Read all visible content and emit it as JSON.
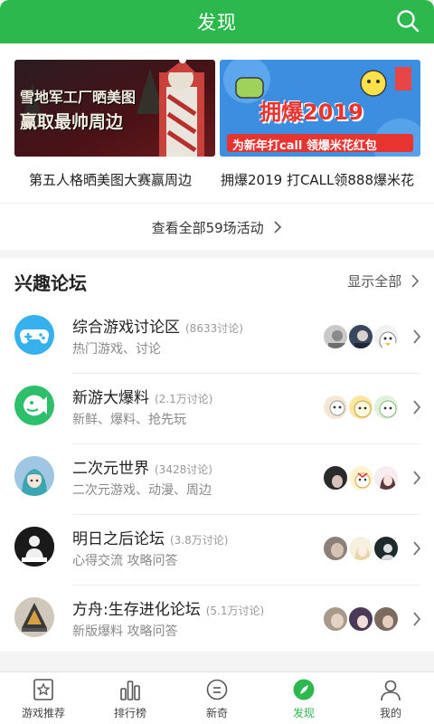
{
  "header": {
    "title": "发现"
  },
  "banners": [
    {
      "image_text_line1": "雪地军工厂晒美图",
      "image_text_line2": "赢取最帅周边",
      "caption": "第五人格晒美图大赛赢周边"
    },
    {
      "image_text_line1": "拥爆2019",
      "image_text_line2": "为新年打call 领爆米花红包",
      "caption": "拥爆2019 打CALL领888爆米花"
    }
  ],
  "all_events": {
    "label": "查看全部59场活动"
  },
  "forum": {
    "title": "兴趣论坛",
    "show_all": "显示全部",
    "items": [
      {
        "name": "综合游戏讨论区",
        "count": "(8633讨论)",
        "sub": "热门游戏、讨论",
        "icon": "gamepad-icon"
      },
      {
        "name": "新游大爆料",
        "count": "(2.1万讨论)",
        "sub": "新鲜、爆料、抢先玩",
        "icon": "fish-chat-icon"
      },
      {
        "name": "二次元世界",
        "count": "(3428讨论)",
        "sub": "二次元游戏、动漫、周边",
        "icon": "anime-girl-icon"
      },
      {
        "name": "明日之后论坛",
        "count": "(3.8万讨论)",
        "sub": "心得交流 攻略问答",
        "icon": "survivor-icon"
      },
      {
        "name": "方舟:生存进化论坛",
        "count": "(5.1万讨论)",
        "sub": "新版爆料 攻略问答",
        "icon": "ark-icon"
      }
    ]
  },
  "tabs": [
    {
      "label": "游戏推荐",
      "icon": "star-card-icon"
    },
    {
      "label": "排行榜",
      "icon": "bar-chart-icon"
    },
    {
      "label": "新奇",
      "icon": "smile-icon"
    },
    {
      "label": "发现",
      "icon": "compass-icon",
      "active": true
    },
    {
      "label": "我的",
      "icon": "person-icon"
    }
  ],
  "colors": {
    "brand": "#2db84d",
    "forum_icon_blue": "#37b0ee",
    "forum_icon_green": "#2dbf6a",
    "banner2_bg": "#3c8fe0",
    "banner1_bg": "#5a1418"
  }
}
